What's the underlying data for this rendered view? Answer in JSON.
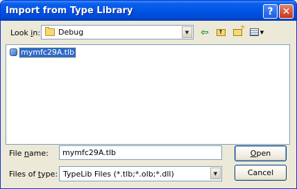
{
  "window": {
    "title": "Import from Type Library",
    "help_button": "?",
    "close_button": "✕"
  },
  "lookin": {
    "label_prefix": "Look ",
    "label_underlined": "i",
    "label_suffix": "n:",
    "value": "Debug"
  },
  "toolbar": {
    "back_icon": "back-arrow-icon",
    "up_icon": "up-folder-icon",
    "new_folder_icon": "new-folder-icon",
    "view_menu_icon": "view-menu-icon"
  },
  "file_list": {
    "items": [
      {
        "name": "mymfc29A.tlb",
        "icon": "type-library-icon",
        "selected": true
      }
    ]
  },
  "file_name": {
    "label_prefix": "File ",
    "label_underlined": "n",
    "label_suffix": "ame:",
    "value": "mymfc29A.tlb"
  },
  "file_type": {
    "label_prefix": "Files of ",
    "label_underlined": "t",
    "label_suffix": "ype:",
    "value": "TypeLib Files (*.tlb;*.olb;*.dll)"
  },
  "buttons": {
    "open_underlined": "O",
    "open_rest": "pen",
    "cancel": "Cancel"
  },
  "colors": {
    "titlebar": "#0055e5",
    "selection": "#316ac5",
    "dialog_bg": "#ece9d8"
  }
}
